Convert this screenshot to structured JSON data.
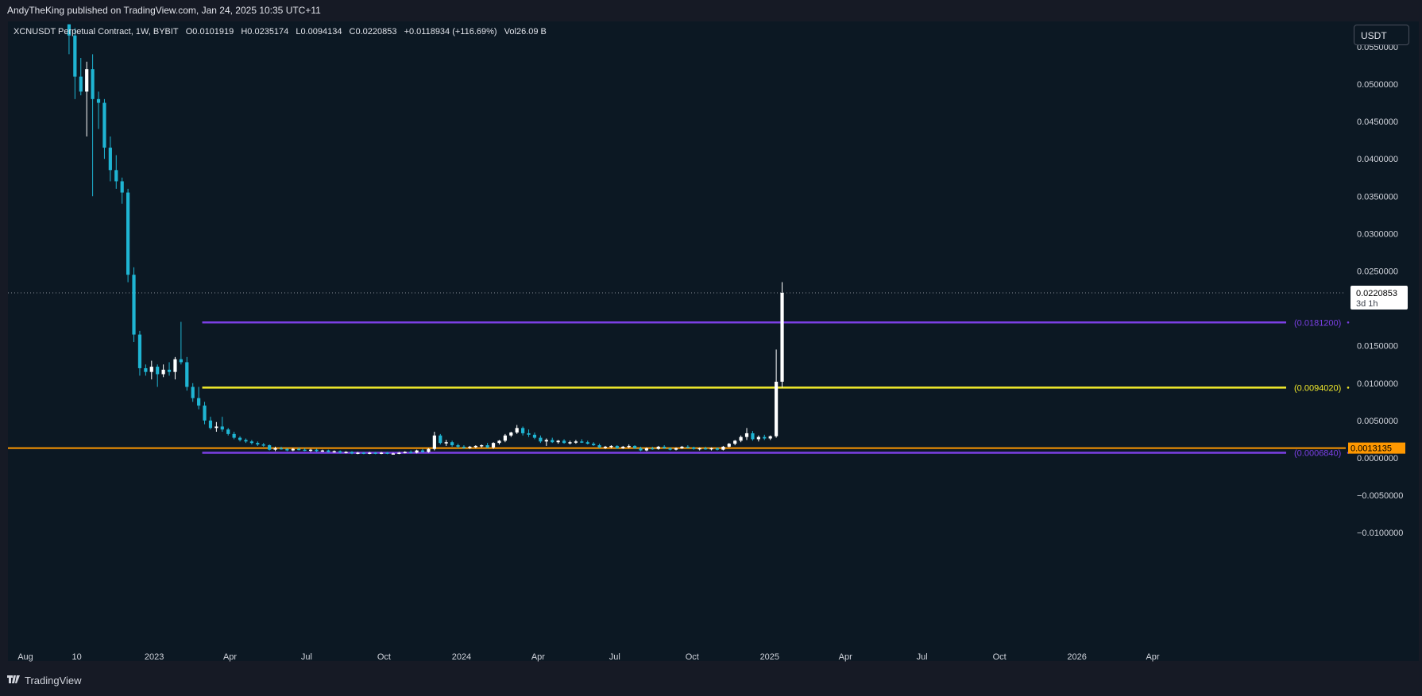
{
  "header": {
    "publisher": "AndyTheKing published on TradingView.com, Jan 24, 2025 10:35 UTC+11"
  },
  "legend": {
    "symbol": "XCNUSDT Perpetual Contract, 1W, BYBIT",
    "open": "O0.0101919",
    "high": "H0.0235174",
    "low": "L0.0094134",
    "close": "C0.0220853",
    "change": "+0.0118934 (+116.69%)",
    "volume": "Vol26.09 B"
  },
  "currency_button": "USDT",
  "footer": {
    "brand": "TradingView",
    "logo_icon": "tradingview-logo-icon"
  },
  "colors": {
    "up": "#ffffff",
    "down": "#1fb5d3",
    "purple": "#7b3fe4",
    "yellow": "#f2ea2b",
    "orange": "#ff9800",
    "background": "#0c1823"
  },
  "chart_data": {
    "type": "candlestick",
    "title": "XCNUSDT Perpetual Contract, 1W, BYBIT",
    "x_ticks": [
      "Aug",
      "10",
      "2023",
      "Apr",
      "Jul",
      "Oct",
      "2024",
      "Apr",
      "Jul",
      "Oct",
      "2025",
      "Apr",
      "Jul",
      "Oct",
      "2026",
      "Apr"
    ],
    "x_tick_dates": [
      "2022-08-01",
      "2022-10-01",
      "2023-01-01",
      "2023-04-01",
      "2023-07-01",
      "2023-10-01",
      "2024-01-01",
      "2024-04-01",
      "2024-07-01",
      "2024-10-01",
      "2025-01-01",
      "2025-04-01",
      "2025-07-01",
      "2025-10-01",
      "2026-01-01",
      "2026-04-01"
    ],
    "y_ticks": [
      "0.0550000",
      "0.0500000",
      "0.0450000",
      "0.0400000",
      "0.0350000",
      "0.0300000",
      "0.0250000",
      "0.0150000",
      "0.0100000",
      "0.0050000",
      "0.0000000",
      "−0.0050000",
      "−0.0100000"
    ],
    "ylim": [
      -0.0125,
      0.06
    ],
    "current_price": {
      "value": 0.0220853,
      "label": "0.0220853",
      "countdown": "3d 1h"
    },
    "horizontal_levels": [
      {
        "name": "purple-top",
        "value": 0.01812,
        "label": "(0.0181200)",
        "color": "#7b3fe4",
        "x_start": "2023-02-27"
      },
      {
        "name": "yellow",
        "value": 0.009402,
        "label": "(0.0094020)",
        "color": "#f2ea2b",
        "x_start": "2023-02-27"
      },
      {
        "name": "orange",
        "value": 0.0013135,
        "label": "0.0013135",
        "color": "#ff9800",
        "x_start": "2022-07-28"
      },
      {
        "name": "purple-bottom",
        "value": 0.000684,
        "label": "(0.0006840)",
        "color": "#7b3fe4",
        "x_start": "2023-02-27"
      }
    ],
    "candles": [
      [
        "2022-09-19",
        0.058,
        0.058,
        0.054,
        0.0565
      ],
      [
        "2022-09-26",
        0.0565,
        0.0575,
        0.048,
        0.051
      ],
      [
        "2022-10-03",
        0.051,
        0.0535,
        0.0485,
        0.049
      ],
      [
        "2022-10-10",
        0.049,
        0.053,
        0.043,
        0.052
      ],
      [
        "2022-10-17",
        0.052,
        0.054,
        0.035,
        0.048
      ],
      [
        "2022-10-24",
        0.048,
        0.049,
        0.044,
        0.0475
      ],
      [
        "2022-10-31",
        0.0475,
        0.048,
        0.04,
        0.0415
      ],
      [
        "2022-11-07",
        0.0415,
        0.043,
        0.037,
        0.0385
      ],
      [
        "2022-11-14",
        0.0385,
        0.0405,
        0.036,
        0.037
      ],
      [
        "2022-11-21",
        0.037,
        0.0375,
        0.034,
        0.0355
      ],
      [
        "2022-11-28",
        0.0355,
        0.036,
        0.0235,
        0.0245
      ],
      [
        "2022-12-05",
        0.0245,
        0.0255,
        0.0155,
        0.0165
      ],
      [
        "2022-12-12",
        0.0165,
        0.017,
        0.011,
        0.012
      ],
      [
        "2022-12-19",
        0.012,
        0.0125,
        0.011,
        0.0115
      ],
      [
        "2022-12-26",
        0.0115,
        0.013,
        0.0105,
        0.0122
      ],
      [
        "2023-01-02",
        0.0122,
        0.0125,
        0.0095,
        0.0112
      ],
      [
        "2023-01-09",
        0.0112,
        0.0125,
        0.0108,
        0.0118
      ],
      [
        "2023-01-16",
        0.0118,
        0.0128,
        0.011,
        0.0115
      ],
      [
        "2023-01-23",
        0.0115,
        0.0135,
        0.0105,
        0.0132
      ],
      [
        "2023-01-30",
        0.0132,
        0.0182,
        0.0125,
        0.0128
      ],
      [
        "2023-02-06",
        0.0128,
        0.0135,
        0.009,
        0.0095
      ],
      [
        "2023-02-13",
        0.0095,
        0.01,
        0.0075,
        0.008
      ],
      [
        "2023-02-20",
        0.008,
        0.0095,
        0.0065,
        0.007
      ],
      [
        "2023-02-27",
        0.007,
        0.0075,
        0.0045,
        0.005
      ],
      [
        "2023-03-06",
        0.005,
        0.0055,
        0.0038,
        0.004
      ],
      [
        "2023-03-13",
        0.004,
        0.0048,
        0.0035,
        0.0042
      ],
      [
        "2023-03-20",
        0.0042,
        0.0055,
        0.0035,
        0.0038
      ],
      [
        "2023-03-27",
        0.0038,
        0.004,
        0.003,
        0.0032
      ],
      [
        "2023-04-03",
        0.0032,
        0.0035,
        0.0025,
        0.0027
      ],
      [
        "2023-04-10",
        0.0027,
        0.0029,
        0.0022,
        0.0024
      ],
      [
        "2023-04-17",
        0.0024,
        0.0026,
        0.002,
        0.0022
      ],
      [
        "2023-04-24",
        0.0022,
        0.0024,
        0.0018,
        0.002
      ],
      [
        "2023-05-01",
        0.002,
        0.0022,
        0.0016,
        0.0018
      ],
      [
        "2023-05-08",
        0.0018,
        0.002,
        0.0015,
        0.0017
      ],
      [
        "2023-05-15",
        0.0017,
        0.0018,
        0.001,
        0.0011
      ],
      [
        "2023-05-22",
        0.0011,
        0.0015,
        0.0009,
        0.0013
      ],
      [
        "2023-05-29",
        0.0013,
        0.0015,
        0.0011,
        0.0012
      ],
      [
        "2023-06-05",
        0.0012,
        0.0013,
        0.0009,
        0.001
      ],
      [
        "2023-06-12",
        0.001,
        0.0013,
        0.0009,
        0.0012
      ],
      [
        "2023-06-19",
        0.0012,
        0.0014,
        0.001,
        0.0011
      ],
      [
        "2023-06-26",
        0.0011,
        0.0013,
        0.0009,
        0.001
      ],
      [
        "2023-07-03",
        0.001,
        0.0012,
        0.0008,
        0.0011
      ],
      [
        "2023-07-10",
        0.0011,
        0.0012,
        0.0008,
        0.0009
      ],
      [
        "2023-07-17",
        0.0009,
        0.0011,
        0.0008,
        0.001
      ],
      [
        "2023-07-24",
        0.001,
        0.0011,
        0.0007,
        0.0008
      ],
      [
        "2023-07-31",
        0.0008,
        0.001,
        0.0007,
        0.0009
      ],
      [
        "2023-08-07",
        0.0009,
        0.001,
        0.0006,
        0.0007
      ],
      [
        "2023-08-14",
        0.0007,
        0.0009,
        0.0006,
        0.0008
      ],
      [
        "2023-08-21",
        0.0008,
        0.0009,
        0.0005,
        0.0006
      ],
      [
        "2023-08-28",
        0.0006,
        0.0008,
        0.0005,
        0.0007
      ],
      [
        "2023-09-04",
        0.0007,
        0.0008,
        0.0005,
        0.0006
      ],
      [
        "2023-09-11",
        0.0006,
        0.0008,
        0.0005,
        0.0007
      ],
      [
        "2023-09-18",
        0.0007,
        0.0008,
        0.0005,
        0.0006
      ],
      [
        "2023-09-25",
        0.0006,
        0.0008,
        0.0005,
        0.0007
      ],
      [
        "2023-10-02",
        0.0007,
        0.0008,
        0.0005,
        0.0006
      ],
      [
        "2023-10-09",
        0.0006,
        0.0007,
        0.0005,
        0.0006
      ],
      [
        "2023-10-16",
        0.0006,
        0.0008,
        0.0005,
        0.0007
      ],
      [
        "2023-10-23",
        0.0007,
        0.0009,
        0.0006,
        0.0008
      ],
      [
        "2023-10-30",
        0.0008,
        0.001,
        0.0006,
        0.0007
      ],
      [
        "2023-11-06",
        0.0007,
        0.0011,
        0.0006,
        0.001
      ],
      [
        "2023-11-13",
        0.001,
        0.0012,
        0.0007,
        0.0008
      ],
      [
        "2023-11-20",
        0.0008,
        0.0013,
        0.0007,
        0.0012
      ],
      [
        "2023-11-27",
        0.0012,
        0.0035,
        0.001,
        0.003
      ],
      [
        "2023-12-04",
        0.003,
        0.0032,
        0.0018,
        0.002
      ],
      [
        "2023-12-11",
        0.002,
        0.0024,
        0.0016,
        0.0021
      ],
      [
        "2023-12-18",
        0.0021,
        0.0023,
        0.0015,
        0.0017
      ],
      [
        "2023-12-25",
        0.0017,
        0.0019,
        0.0013,
        0.0015
      ],
      [
        "2024-01-01",
        0.0015,
        0.0017,
        0.0012,
        0.0014
      ],
      [
        "2024-01-08",
        0.0014,
        0.0016,
        0.0012,
        0.0015
      ],
      [
        "2024-01-15",
        0.0015,
        0.0017,
        0.0013,
        0.0016
      ],
      [
        "2024-01-22",
        0.0016,
        0.0018,
        0.0014,
        0.0017
      ],
      [
        "2024-01-29",
        0.0017,
        0.002,
        0.0013,
        0.0014
      ],
      [
        "2024-02-05",
        0.0014,
        0.0021,
        0.0012,
        0.002
      ],
      [
        "2024-02-12",
        0.002,
        0.0024,
        0.0018,
        0.0023
      ],
      [
        "2024-02-19",
        0.0023,
        0.0032,
        0.0021,
        0.003
      ],
      [
        "2024-02-26",
        0.003,
        0.0035,
        0.0028,
        0.0034
      ],
      [
        "2024-03-04",
        0.0034,
        0.0044,
        0.0032,
        0.004
      ],
      [
        "2024-03-11",
        0.004,
        0.0042,
        0.003,
        0.0033
      ],
      [
        "2024-03-18",
        0.0033,
        0.0038,
        0.0028,
        0.0031
      ],
      [
        "2024-03-25",
        0.0031,
        0.0034,
        0.0025,
        0.0027
      ],
      [
        "2024-04-01",
        0.0027,
        0.003,
        0.002,
        0.0022
      ],
      [
        "2024-04-08",
        0.0022,
        0.0026,
        0.0016,
        0.0024
      ],
      [
        "2024-04-15",
        0.0024,
        0.0027,
        0.002,
        0.0021
      ],
      [
        "2024-04-22",
        0.0021,
        0.0024,
        0.0019,
        0.0023
      ],
      [
        "2024-04-29",
        0.0023,
        0.0025,
        0.0019,
        0.002
      ],
      [
        "2024-05-06",
        0.002,
        0.0023,
        0.0018,
        0.0021
      ],
      [
        "2024-05-13",
        0.0021,
        0.0024,
        0.0019,
        0.0022
      ],
      [
        "2024-05-20",
        0.0022,
        0.0025,
        0.002,
        0.0021
      ],
      [
        "2024-05-27",
        0.0021,
        0.0023,
        0.0018,
        0.0019
      ],
      [
        "2024-06-03",
        0.0019,
        0.0021,
        0.0016,
        0.0017
      ],
      [
        "2024-06-10",
        0.0017,
        0.0019,
        0.0013,
        0.0014
      ],
      [
        "2024-06-17",
        0.0014,
        0.0016,
        0.0012,
        0.0015
      ],
      [
        "2024-06-24",
        0.0015,
        0.0017,
        0.0013,
        0.0016
      ],
      [
        "2024-07-01",
        0.0016,
        0.0017,
        0.0012,
        0.0013
      ],
      [
        "2024-07-08",
        0.0013,
        0.0016,
        0.0012,
        0.0015
      ],
      [
        "2024-07-15",
        0.0015,
        0.0018,
        0.0013,
        0.0016
      ],
      [
        "2024-07-22",
        0.0016,
        0.0017,
        0.0012,
        0.0013
      ],
      [
        "2024-07-29",
        0.0013,
        0.0015,
        0.0009,
        0.001
      ],
      [
        "2024-08-05",
        0.001,
        0.0014,
        0.0009,
        0.0013
      ],
      [
        "2024-08-12",
        0.0013,
        0.0015,
        0.0011,
        0.0012
      ],
      [
        "2024-08-19",
        0.0012,
        0.0016,
        0.0011,
        0.0015
      ],
      [
        "2024-08-26",
        0.0015,
        0.0017,
        0.0012,
        0.0013
      ],
      [
        "2024-09-02",
        0.0013,
        0.0014,
        0.001,
        0.0011
      ],
      [
        "2024-09-09",
        0.0011,
        0.0014,
        0.001,
        0.0013
      ],
      [
        "2024-09-16",
        0.0013,
        0.0016,
        0.0012,
        0.0015
      ],
      [
        "2024-09-23",
        0.0015,
        0.0017,
        0.0013,
        0.0014
      ],
      [
        "2024-09-30",
        0.0014,
        0.0015,
        0.0011,
        0.0012
      ],
      [
        "2024-10-07",
        0.0012,
        0.0014,
        0.001,
        0.0013
      ],
      [
        "2024-10-14",
        0.0013,
        0.0015,
        0.0011,
        0.0012
      ],
      [
        "2024-10-21",
        0.0012,
        0.0014,
        0.001,
        0.0013
      ],
      [
        "2024-10-28",
        0.0013,
        0.0014,
        0.001,
        0.0011
      ],
      [
        "2024-11-04",
        0.0011,
        0.0016,
        0.001,
        0.0015
      ],
      [
        "2024-11-11",
        0.0015,
        0.002,
        0.0014,
        0.0019
      ],
      [
        "2024-11-18",
        0.0019,
        0.0024,
        0.0017,
        0.0023
      ],
      [
        "2024-11-25",
        0.0023,
        0.003,
        0.0021,
        0.0028
      ],
      [
        "2024-12-02",
        0.0028,
        0.004,
        0.0024,
        0.0033
      ],
      [
        "2024-12-09",
        0.0033,
        0.0036,
        0.0023,
        0.0025
      ],
      [
        "2024-12-16",
        0.0025,
        0.003,
        0.0022,
        0.0028
      ],
      [
        "2024-12-23",
        0.0028,
        0.0031,
        0.0024,
        0.0026
      ],
      [
        "2024-12-30",
        0.0026,
        0.003,
        0.0024,
        0.0029
      ],
      [
        "2025-01-06",
        0.0029,
        0.0145,
        0.0027,
        0.0101919
      ],
      [
        "2025-01-13",
        0.0101919,
        0.0235174,
        0.0094134,
        0.0220853
      ]
    ]
  }
}
